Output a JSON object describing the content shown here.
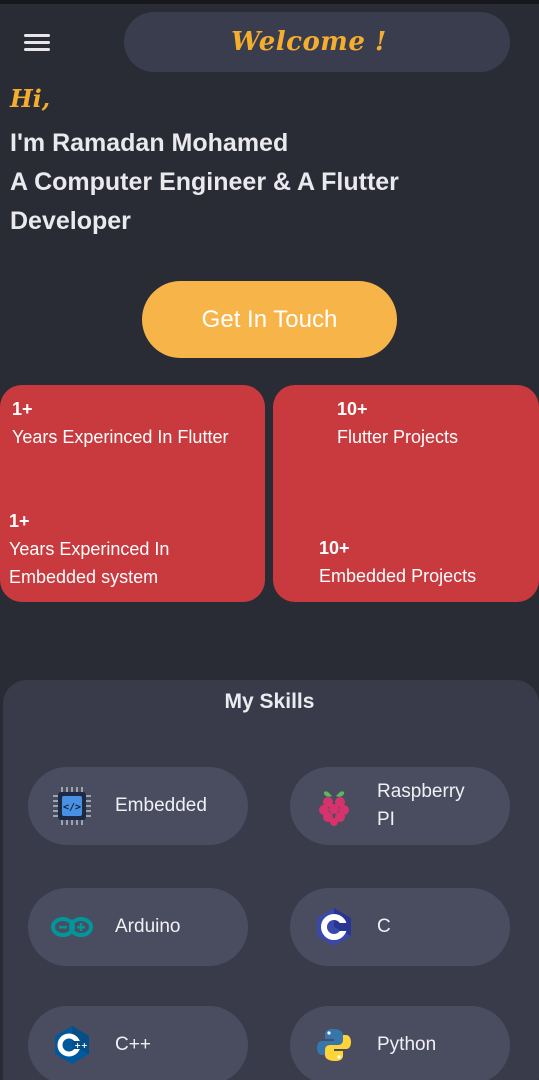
{
  "header": {
    "title": "Welcome !",
    "menu_icon": "hamburger-menu-icon",
    "accent_color": "#f4ad2e"
  },
  "intro": {
    "greeting": "Hi,",
    "name_line": "I'm Ramadan Mohamed",
    "role_line_1": "A Computer Engineer & A Flutter",
    "role_line_2": "Developer"
  },
  "cta": {
    "label": "Get In Touch",
    "color": "#f7b449"
  },
  "stats": {
    "card_color": "#c83a3e",
    "flutter_years": {
      "value": "1+",
      "label": "Years Experinced In Flutter"
    },
    "embedded_years": {
      "value": "1+",
      "label_1": "Years Experinced In",
      "label_2": "Embedded system"
    },
    "flutter_projects": {
      "value": "10+",
      "label": "Flutter Projects"
    },
    "embedded_projects": {
      "value": "10+",
      "label": "Embedded Projects"
    }
  },
  "skills": {
    "title": "My Skills",
    "items": [
      {
        "label": "Embedded",
        "icon": "chip-icon"
      },
      {
        "label_1": "Raspberry",
        "label_2": "PI",
        "icon": "raspberry-pi-icon"
      },
      {
        "label": "Arduino",
        "icon": "arduino-icon"
      },
      {
        "label": "C",
        "icon": "c-language-icon"
      },
      {
        "label": "C++",
        "icon": "cpp-language-icon"
      },
      {
        "label": "Python",
        "icon": "python-icon"
      }
    ]
  }
}
